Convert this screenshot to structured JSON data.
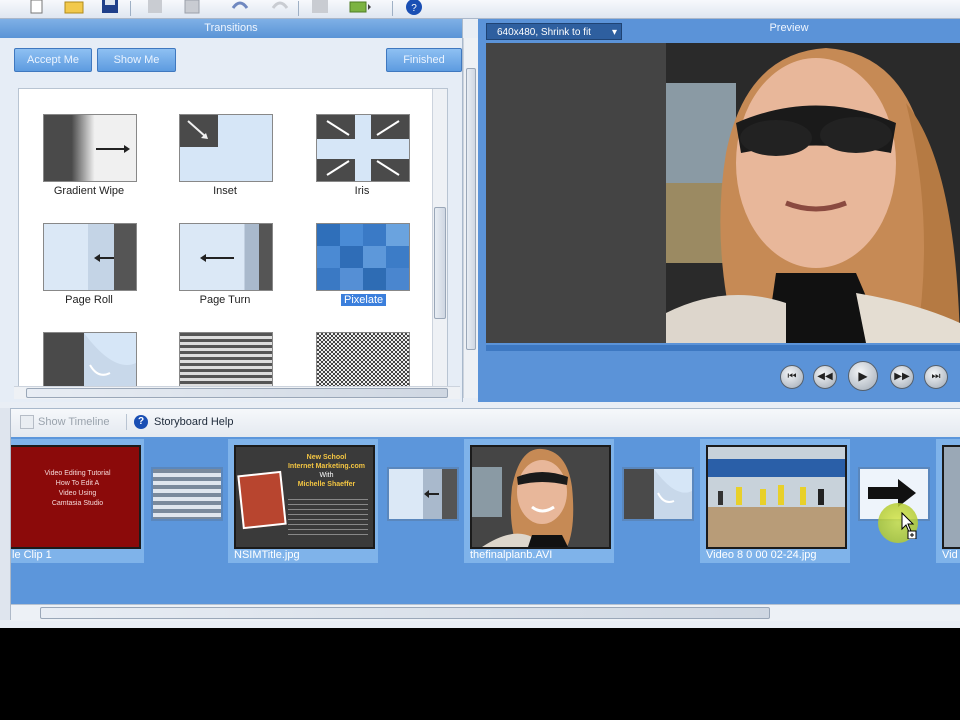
{
  "toolbar": {
    "icons": [
      "new-file-icon",
      "open-folder-icon",
      "save-icon",
      "cut-icon",
      "copy-icon",
      "undo-icon",
      "redo-icon",
      "import-icon",
      "produce-icon",
      "help-icon"
    ]
  },
  "transitions": {
    "title": "Transitions",
    "accept_me": "Accept Me",
    "show_me": "Show Me",
    "finished": "Finished",
    "items": [
      {
        "label": "Gradient Wipe"
      },
      {
        "label": "Inset"
      },
      {
        "label": "Iris"
      },
      {
        "label": "Page Roll"
      },
      {
        "label": "Page Turn"
      },
      {
        "label": "Pixelate",
        "selected": true
      },
      {
        "label": ""
      },
      {
        "label": ""
      },
      {
        "label": ""
      }
    ]
  },
  "preview": {
    "size_dropdown": "640x480, Shrink to fit",
    "title": "Preview"
  },
  "storyboard": {
    "show_timeline": "Show Timeline",
    "help": "Storyboard Help",
    "clips": [
      {
        "name": "le Clip 1",
        "text": [
          "Video Editing Tutorial",
          "How To Edit A",
          "Video Using",
          "Camtasia Studio"
        ]
      },
      {
        "name": "NSIMTitle.jpg",
        "text": [
          "New School",
          "Internet Marketing.com",
          "With",
          "Michelle Shaeffer"
        ]
      },
      {
        "name": "thefinalplanb.AVI"
      },
      {
        "name": "Video 8 0 00 02-24.jpg"
      },
      {
        "name": "Vid"
      }
    ]
  },
  "colors": {
    "panel_blue": "#5c96db",
    "header_blue": "#6aa2e0",
    "selection": "#3b7fdc",
    "title_red": "#8b0a0a"
  }
}
